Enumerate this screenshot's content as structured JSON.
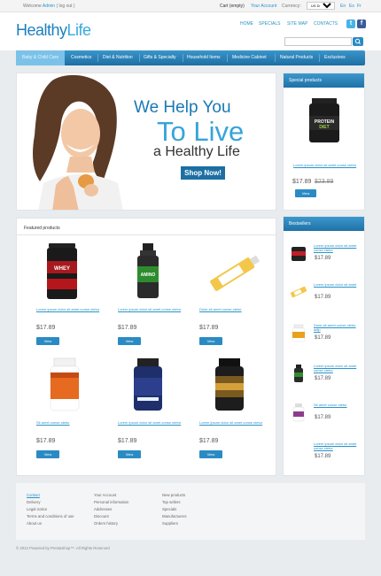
{
  "topbar": {
    "welcome_prefix": "Welcome",
    "user": "Admin",
    "logout": "( log out )",
    "cart": "Cart (empty)",
    "account": "Your Account",
    "currency_label": "Currency:",
    "currency_value": "US Dollar",
    "langs": [
      "En",
      "Es",
      "Fr"
    ]
  },
  "header": {
    "logo_a": "Healthy",
    "logo_b": "Life",
    "nav": [
      "HOME",
      "SPECIALS",
      "SITE MAP",
      "CONTACTS"
    ],
    "search_placeholder": "",
    "social": [
      {
        "name": "twitter-icon",
        "glyph": "t",
        "color": "#46b4e6"
      },
      {
        "name": "facebook-icon",
        "glyph": "f",
        "color": "#3b5c9a"
      }
    ]
  },
  "navbar": [
    "Baby & Child Care",
    "Cosmetics",
    "Diet & Nutrition",
    "Gifts & Specialty",
    "Household Items",
    "Medicine Cabinet",
    "Natural Products",
    "Exclusives"
  ],
  "hero": {
    "line1": "We Help You",
    "line2": "To Live",
    "line3": "a Healthy Life",
    "button": "Shop Now!"
  },
  "featured": {
    "title": "Featured products",
    "items": [
      {
        "name": "Lorem ipsum dolor sit amet conse ctetur",
        "price": "$17.89",
        "view": "View"
      },
      {
        "name": "Lorem ipsum dolor sit amet conse ctetur",
        "price": "$17.89",
        "view": "View"
      },
      {
        "name": "Dolor sit amet conse ctetur",
        "price": "$17.89",
        "view": "View"
      },
      {
        "name": "Sit amet conse ctetur",
        "price": "$17.89",
        "view": "View"
      },
      {
        "name": "Lorem ipsum dolor sit amet conse ctetur",
        "price": "$17.89",
        "view": "View"
      },
      {
        "name": "Lorem ipsum dolor sit amet conse ctetur",
        "price": "$17.89",
        "view": "View"
      }
    ]
  },
  "special": {
    "title": "Special products",
    "name": "Lorem ipsum dolor sit amet conse ctetur",
    "price": "$17.89",
    "old_price": "$23.89",
    "view": "View"
  },
  "bestsellers": {
    "title": "Bestsellers",
    "items": [
      {
        "name": "Lorem ipsum dolor sit amet conse ctetur",
        "price": "$17.89"
      },
      {
        "name": "Lorem ipsum dolor sit amet",
        "price": "$17.89"
      },
      {
        "name": "Dolor sit amet conse ctetur adip",
        "price": "$17.89"
      },
      {
        "name": "Lorem ipsum dolor sit amet conse ctetur",
        "price": "$17.89"
      },
      {
        "name": "Sit amet conse ctetur",
        "price": "$17.89"
      },
      {
        "name": "Lorem ipsum dolor sit amet conse ctetur",
        "price": "$17.89"
      }
    ]
  },
  "footer": {
    "col1": [
      "Contact",
      "Delivery",
      "Legal notice",
      "Terms and conditions of use",
      "About us"
    ],
    "col2": [
      "Your Account",
      "Personal information",
      "Addresses",
      "Discount",
      "Orders history"
    ],
    "col3": [
      "New products",
      "Top sellers",
      "Specials",
      "Manufacturers",
      "Suppliers"
    ],
    "copyright": "© 2012 Powered by PrestaShop™. All Rights Reserved"
  }
}
